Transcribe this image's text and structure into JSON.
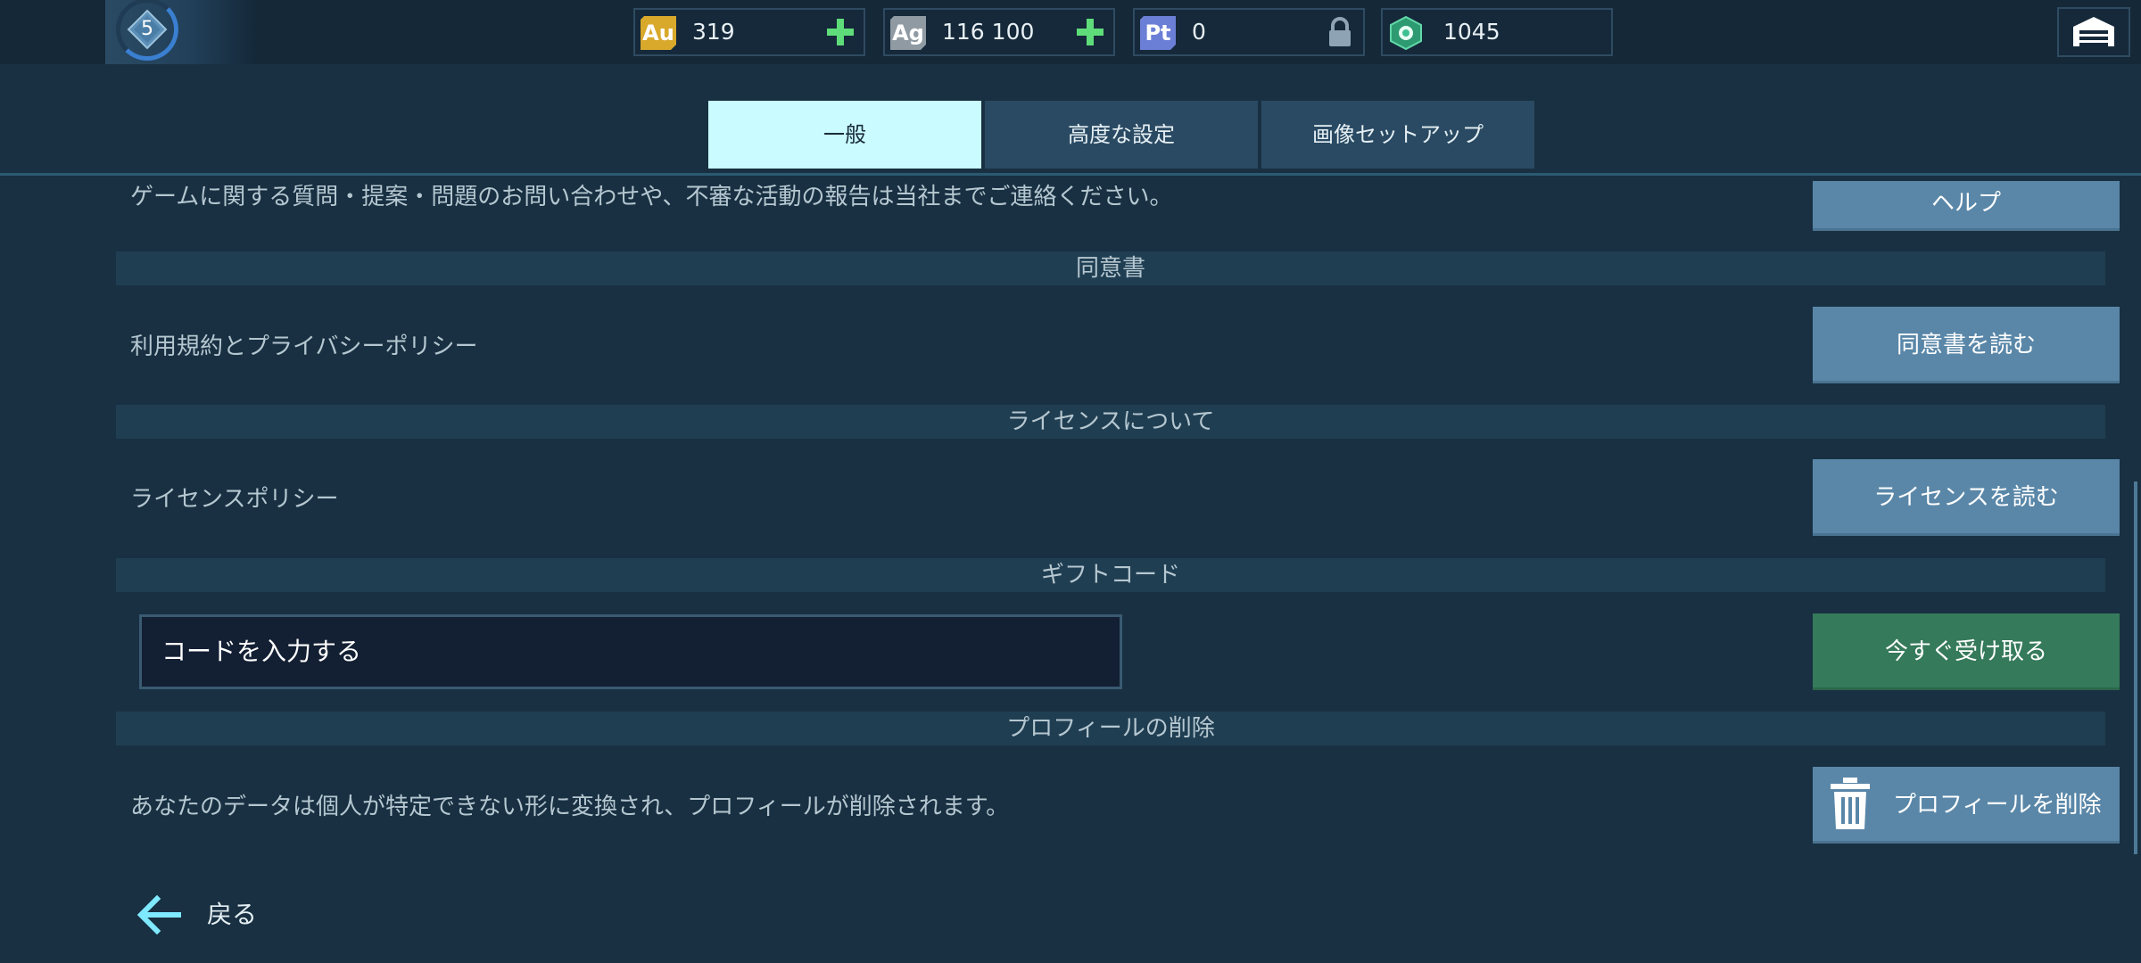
{
  "player": {
    "level": "5"
  },
  "currencies": [
    {
      "symbol": "Au",
      "value": "319",
      "color": "#d9a92c",
      "action": "plus-icon"
    },
    {
      "symbol": "Ag",
      "value": "116 100",
      "color": "#8f9aa3",
      "action": "plus-icon"
    },
    {
      "symbol": "Pt",
      "value": "0",
      "color": "#6c7fd6",
      "action": "lock-icon"
    },
    {
      "symbol": "",
      "value": "1045",
      "color": "#3fc090",
      "action": ""
    }
  ],
  "tabs": [
    {
      "label": "一般",
      "active": true
    },
    {
      "label": "高度な設定",
      "active": false
    },
    {
      "label": "画像セットアップ",
      "active": false
    }
  ],
  "support": {
    "text": "ゲームに関する質問・提案・問題のお問い合わせや、不審な活動の報告は当社までご連絡ください。",
    "button": "ヘルプ"
  },
  "agreement": {
    "header": "同意書",
    "text": "利用規約とプライバシーポリシー",
    "button": "同意書を読む"
  },
  "license": {
    "header": "ライセンスについて",
    "text": "ライセンスポリシー",
    "button": "ライセンスを読む"
  },
  "gift": {
    "header": "ギフトコード",
    "placeholder": "コードを入力する",
    "button": "今すぐ受け取る"
  },
  "delete_profile": {
    "header": "プロフィールの削除",
    "text": "あなたのデータは個人が特定できない形に変換され、プロフィールが削除されます。",
    "button": "プロフィールを削除"
  },
  "footer": {
    "back_label": "戻る"
  },
  "colors": {
    "accent_tab": "#c9fbff",
    "button": "#5a87a8",
    "button_green": "#357a5a"
  }
}
